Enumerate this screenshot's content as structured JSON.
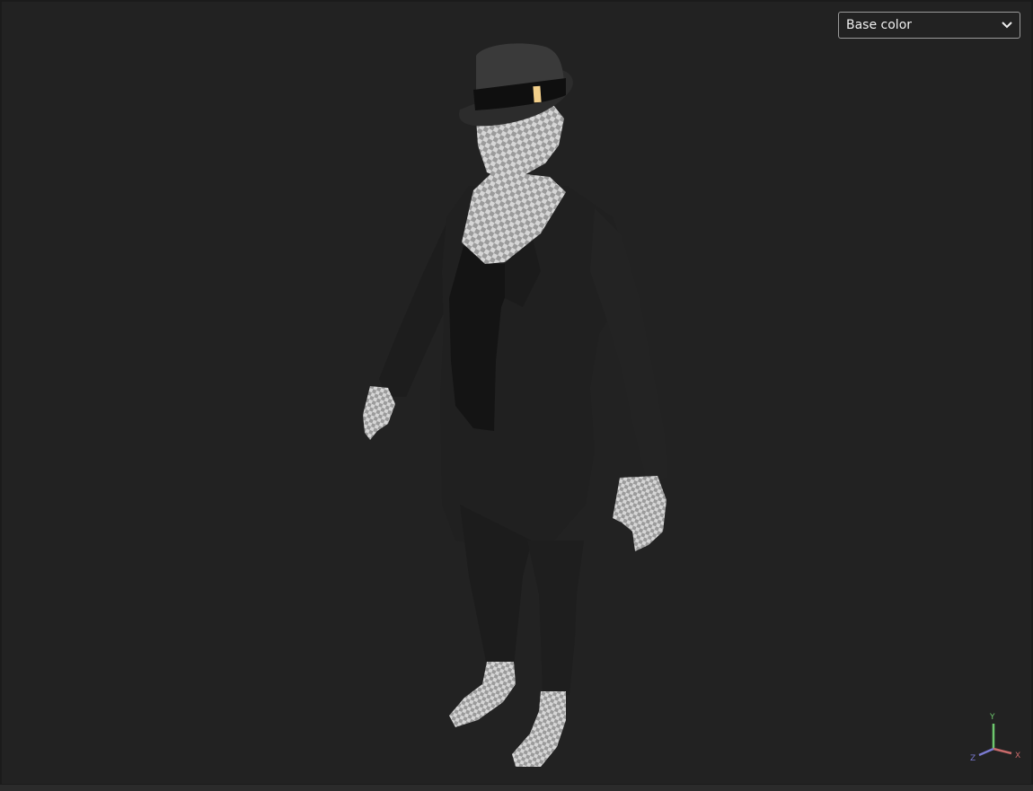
{
  "viewer": {
    "display_mode": {
      "selected": "Base color"
    },
    "axis_gizmo": {
      "x_label": "X",
      "y_label": "Y",
      "z_label": "Z",
      "x_color": "#c86a6a",
      "y_color": "#6ec86e",
      "z_color": "#7a7ad0"
    },
    "model": {
      "icon": "checker-textured-character",
      "hat_color": "#3a3a3a",
      "band_color": "#111111",
      "buckle_color": "#f2cf8a",
      "cloth_color": "#1e1e1e",
      "skin_checker_light": "#d8d8d8",
      "skin_checker_dark": "#9a9a9a"
    }
  }
}
